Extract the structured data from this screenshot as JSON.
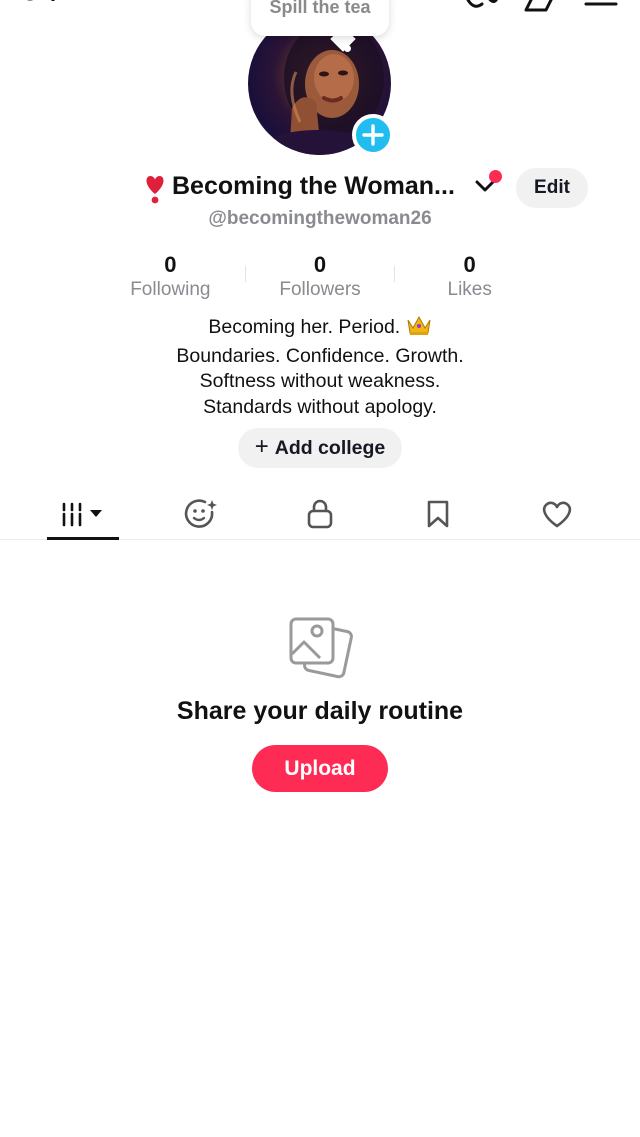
{
  "status_bubble": {
    "text": "Spill the tea"
  },
  "profile": {
    "display_name": "Becoming the Woman...",
    "handle": "@becomingthewoman26",
    "edit_label": "Edit"
  },
  "stats": [
    {
      "value": "0",
      "label": "Following"
    },
    {
      "value": "0",
      "label": "Followers"
    },
    {
      "value": "0",
      "label": "Likes"
    }
  ],
  "bio": {
    "line1": "Becoming her. Period.",
    "line2": "Boundaries. Confidence. Growth.",
    "line3": "Softness without weakness.",
    "line4": "Standards without apology."
  },
  "add_college_label": "Add college",
  "tabs": [
    {
      "icon": "videos-grid-icon",
      "active": true
    },
    {
      "icon": "repost-icon"
    },
    {
      "icon": "lock-icon"
    },
    {
      "icon": "bookmark-icon"
    },
    {
      "icon": "heart-icon"
    }
  ],
  "empty_state": {
    "title": "Share your daily routine",
    "button_label": "Upload"
  },
  "colors": {
    "accent": "#fe2c55",
    "avatar_plus": "#22bdf0",
    "muted_text": "#8a8b91",
    "chip_bg": "#f1f1f2"
  }
}
